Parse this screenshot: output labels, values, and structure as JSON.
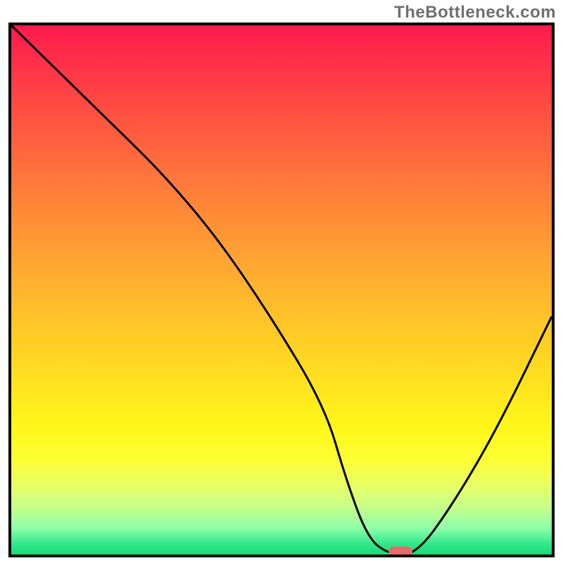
{
  "watermark": "TheBottleneck.com",
  "chart_data": {
    "type": "line",
    "title": "",
    "xlabel": "",
    "ylabel": "",
    "xlim": [
      0,
      100
    ],
    "ylim": [
      0,
      100
    ],
    "x": [
      0,
      8,
      18,
      28,
      38,
      48,
      58,
      62,
      66,
      70,
      75,
      82,
      90,
      100
    ],
    "values": [
      100,
      92,
      82,
      72,
      60,
      45,
      28,
      14,
      3,
      0,
      0,
      10,
      24,
      45
    ],
    "sweet_spot_x": 72,
    "sweet_spot_y": 0,
    "gradient_colors": {
      "top": "#ff1a4d",
      "mid": "#ffe31f",
      "bottom": "#18d977"
    },
    "marker_color": "#e46b6b"
  }
}
